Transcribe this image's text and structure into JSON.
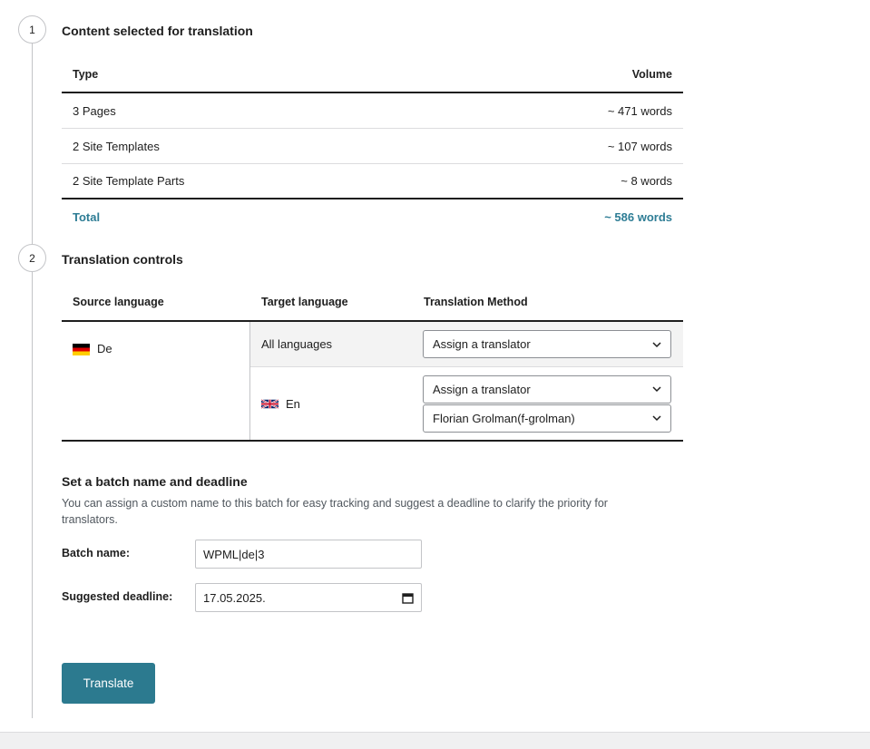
{
  "steps": {
    "one": {
      "number": "1",
      "title": "Content selected for translation"
    },
    "two": {
      "number": "2",
      "title": "Translation controls"
    }
  },
  "volume_table": {
    "headers": {
      "type": "Type",
      "volume": "Volume"
    },
    "rows": [
      {
        "type": "3 Pages",
        "volume": "~ 471 words"
      },
      {
        "type": "2 Site Templates",
        "volume": "~ 107 words"
      },
      {
        "type": "2 Site Template Parts",
        "volume": "~ 8 words"
      }
    ],
    "total": {
      "label": "Total",
      "volume": "~ 586 words"
    }
  },
  "controls_table": {
    "headers": {
      "source": "Source language",
      "target": "Target language",
      "method": "Translation Method"
    },
    "source_language": "De",
    "all_languages": {
      "label": "All languages",
      "method": "Assign a translator"
    },
    "en_row": {
      "label": "En",
      "method": "Assign a translator",
      "translator": "Florian Grolman(f-grolman)"
    }
  },
  "batch": {
    "title": "Set a batch name and deadline",
    "description": "You can assign a custom name to this batch for easy tracking and suggest a deadline to clarify the priority for translators.",
    "name_label": "Batch name:",
    "name_value": "WPML|de|3",
    "deadline_label": "Suggested deadline:",
    "deadline_value": "17.05.2025."
  },
  "translate_button": "Translate",
  "colors": {
    "accent": "#2c7a8f",
    "total_text": "#2e7d95"
  },
  "icons": [
    "calendar-icon",
    "chevron-down-icon",
    "flag-de-icon",
    "flag-gb-icon"
  ]
}
